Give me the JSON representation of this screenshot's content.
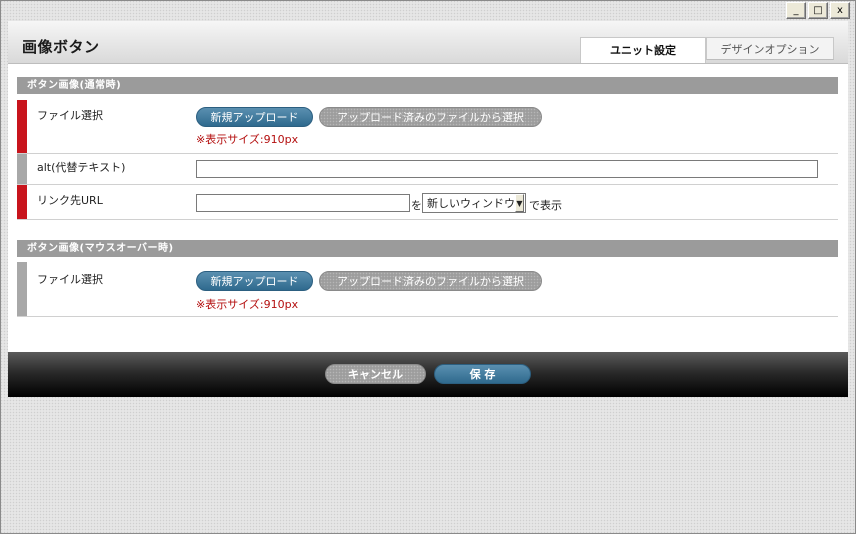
{
  "window": {
    "minimize_glyph": "_",
    "maximize_glyph": "□",
    "close_glyph": "x"
  },
  "header": {
    "title": "画像ボタン",
    "tabs": [
      {
        "label": "ユニット設定",
        "active": true
      },
      {
        "label": "デザインオプション",
        "active": false
      }
    ]
  },
  "section_normal": {
    "title": "ボタン画像(通常時)",
    "file_select": {
      "label": "ファイル選択",
      "upload_button": "新規アップロード",
      "choose_button": "アップロード済みのファイルから選択",
      "note": "※表示サイズ:910px"
    },
    "alt": {
      "label": "alt(代替テキスト)",
      "value": ""
    },
    "link": {
      "label": "リンク先URL",
      "url_value": "",
      "connector": "を",
      "target_selected": "新しいウィンドウ",
      "suffix": "で表示"
    }
  },
  "section_hover": {
    "title": "ボタン画像(マウスオーバー時)",
    "file_select": {
      "label": "ファイル選択",
      "upload_button": "新規アップロード",
      "choose_button": "アップロード済みのファイルから選択",
      "note": "※表示サイズ:910px"
    }
  },
  "footer": {
    "cancel_label": "キャンセル",
    "save_label": "保 存"
  },
  "colors": {
    "required_marker": "#c8141c",
    "optional_marker": "#a8a8a8",
    "primary_button": "#2f6a8e",
    "note_text": "#b40f0f",
    "section_bar": "#9b9b9b"
  }
}
